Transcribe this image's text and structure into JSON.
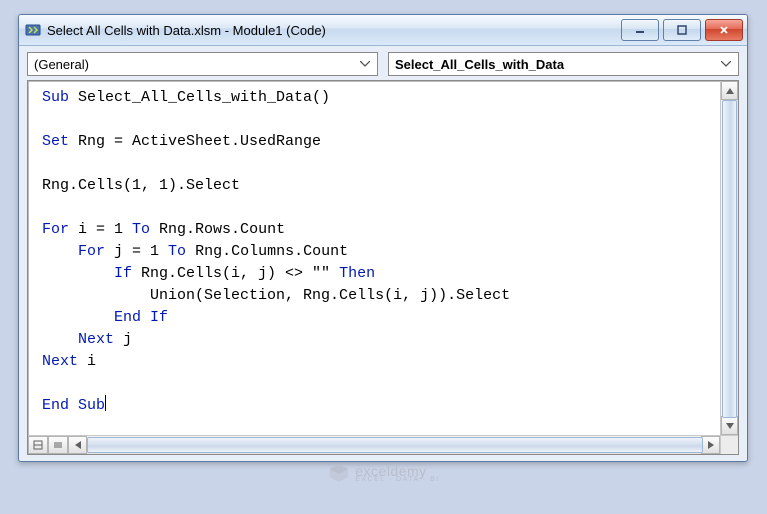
{
  "window": {
    "title": "Select All Cells with Data.xlsm - Module1 (Code)"
  },
  "dropdowns": {
    "object": "(General)",
    "procedure": "Select_All_Cells_with_Data"
  },
  "code": {
    "l1_kw": "Sub",
    "l1_rest": " Select_All_Cells_with_Data()",
    "l3_kw": "Set",
    "l3_rest": " Rng = ActiveSheet.UsedRange",
    "l5": "Rng.Cells(1, 1).Select",
    "l7_kw1": "For",
    "l7_mid": " i = 1 ",
    "l7_kw2": "To",
    "l7_rest": " Rng.Rows.Count",
    "l8_pad": "    ",
    "l8_kw1": "For",
    "l8_mid": " j = 1 ",
    "l8_kw2": "To",
    "l8_rest": " Rng.Columns.Count",
    "l9_pad": "        ",
    "l9_kw1": "If",
    "l9_mid": " Rng.Cells(i, j) <> \"\" ",
    "l9_kw2": "Then",
    "l10_pad": "            ",
    "l10": "Union(Selection, Rng.Cells(i, j)).Select",
    "l11_pad": "        ",
    "l11_kw": "End If",
    "l12_pad": "    ",
    "l12_kw": "Next",
    "l12_rest": " j",
    "l13_kw": "Next",
    "l13_rest": " i",
    "l15_kw": "End Sub"
  },
  "watermark": {
    "brand": "exceldemy",
    "tagline": "EXCEL · DATA · BI"
  }
}
